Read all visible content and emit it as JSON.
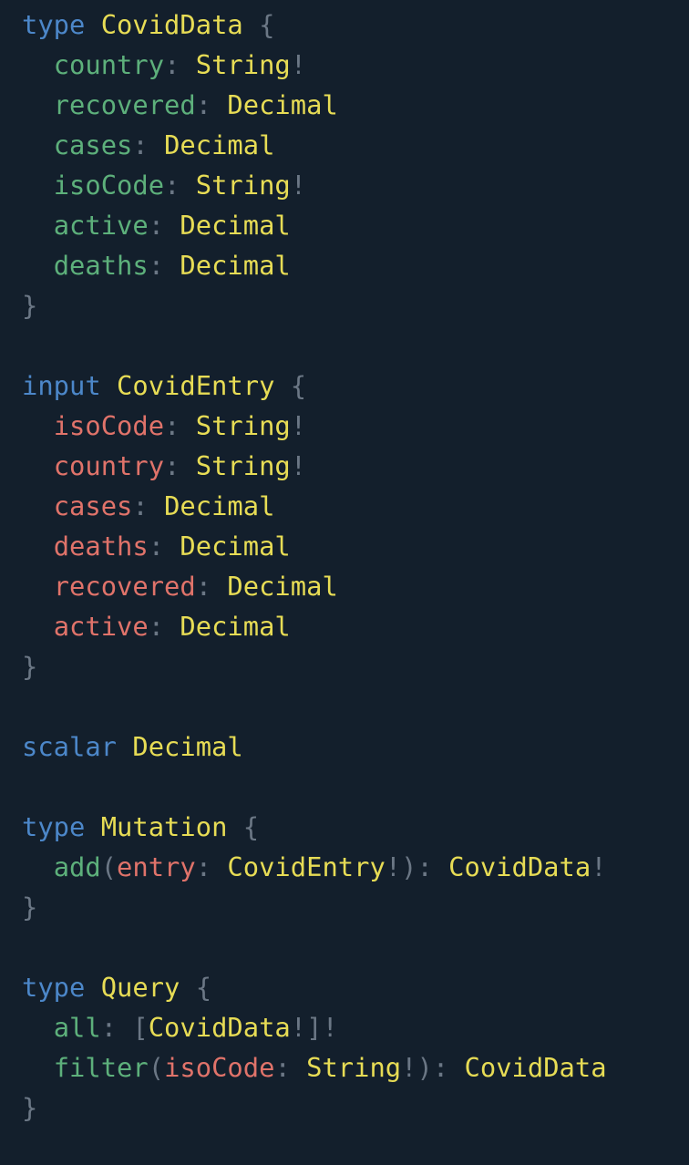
{
  "colors": {
    "background": "#131f2c",
    "keyword": "#4c87c9",
    "type": "#e7dc55",
    "field": "#5db07b",
    "argument": "#e0736a",
    "punctuation": "#6b7785"
  },
  "code_lines": [
    [
      [
        "k",
        "type"
      ],
      [
        "",
        "  "
      ],
      [
        "t",
        "CovidData"
      ],
      [
        "p",
        " {"
      ]
    ],
    [
      [
        "",
        "  "
      ],
      [
        "f",
        "country"
      ],
      [
        "p",
        ": "
      ],
      [
        "t",
        "String"
      ],
      [
        "p",
        "!"
      ]
    ],
    [
      [
        "",
        "  "
      ],
      [
        "f",
        "recovered"
      ],
      [
        "p",
        ": "
      ],
      [
        "t",
        "Decimal"
      ]
    ],
    [
      [
        "",
        "  "
      ],
      [
        "f",
        "cases"
      ],
      [
        "p",
        ": "
      ],
      [
        "t",
        "Decimal"
      ]
    ],
    [
      [
        "",
        "  "
      ],
      [
        "f",
        "isoCode"
      ],
      [
        "p",
        ": "
      ],
      [
        "t",
        "String"
      ],
      [
        "p",
        "!"
      ]
    ],
    [
      [
        "",
        "  "
      ],
      [
        "f",
        "active"
      ],
      [
        "p",
        ": "
      ],
      [
        "t",
        "Decimal"
      ]
    ],
    [
      [
        "",
        "  "
      ],
      [
        "f",
        "deaths"
      ],
      [
        "p",
        ": "
      ],
      [
        "t",
        "Decimal"
      ]
    ],
    [
      [
        "p",
        "}"
      ]
    ],
    [],
    [
      [
        "k",
        "input"
      ],
      [
        "",
        "  "
      ],
      [
        "t",
        "CovidEntry"
      ],
      [
        "p",
        " {"
      ]
    ],
    [
      [
        "",
        "  "
      ],
      [
        "a",
        "isoCode"
      ],
      [
        "p",
        ": "
      ],
      [
        "t",
        "String"
      ],
      [
        "p",
        "!"
      ]
    ],
    [
      [
        "",
        "  "
      ],
      [
        "a",
        "country"
      ],
      [
        "p",
        ": "
      ],
      [
        "t",
        "String"
      ],
      [
        "p",
        "!"
      ]
    ],
    [
      [
        "",
        "  "
      ],
      [
        "a",
        "cases"
      ],
      [
        "p",
        ": "
      ],
      [
        "t",
        "Decimal"
      ]
    ],
    [
      [
        "",
        "  "
      ],
      [
        "a",
        "deaths"
      ],
      [
        "p",
        ": "
      ],
      [
        "t",
        "Decimal"
      ]
    ],
    [
      [
        "",
        "  "
      ],
      [
        "a",
        "recovered"
      ],
      [
        "p",
        ": "
      ],
      [
        "t",
        "Decimal"
      ]
    ],
    [
      [
        "",
        "  "
      ],
      [
        "a",
        "active"
      ],
      [
        "p",
        ": "
      ],
      [
        "t",
        "Decimal"
      ]
    ],
    [
      [
        "p",
        "}"
      ]
    ],
    [],
    [
      [
        "k",
        "scalar"
      ],
      [
        "",
        "  "
      ],
      [
        "t",
        "Decimal"
      ]
    ],
    [],
    [
      [
        "k",
        "type"
      ],
      [
        "",
        "  "
      ],
      [
        "t",
        "Mutation"
      ],
      [
        "p",
        " {"
      ]
    ],
    [
      [
        "",
        "  "
      ],
      [
        "f",
        "add"
      ],
      [
        "p",
        "("
      ],
      [
        "a",
        "entry"
      ],
      [
        "p",
        ": "
      ],
      [
        "t",
        "CovidEntry"
      ],
      [
        "p",
        "!): "
      ],
      [
        "t",
        "CovidData"
      ],
      [
        "p",
        "!"
      ]
    ],
    [
      [
        "p",
        "}"
      ]
    ],
    [],
    [
      [
        "k",
        "type"
      ],
      [
        "",
        "  "
      ],
      [
        "t",
        "Query"
      ],
      [
        "p",
        " {"
      ]
    ],
    [
      [
        "",
        "  "
      ],
      [
        "f",
        "all"
      ],
      [
        "p",
        ": ["
      ],
      [
        "t",
        "CovidData"
      ],
      [
        "p",
        "!]!"
      ]
    ],
    [
      [
        "",
        "  "
      ],
      [
        "f",
        "filter"
      ],
      [
        "p",
        "("
      ],
      [
        "a",
        "isoCode"
      ],
      [
        "p",
        ": "
      ],
      [
        "t",
        "String"
      ],
      [
        "p",
        "!): "
      ],
      [
        "t",
        "CovidData"
      ]
    ],
    [
      [
        "p",
        "}"
      ]
    ]
  ]
}
